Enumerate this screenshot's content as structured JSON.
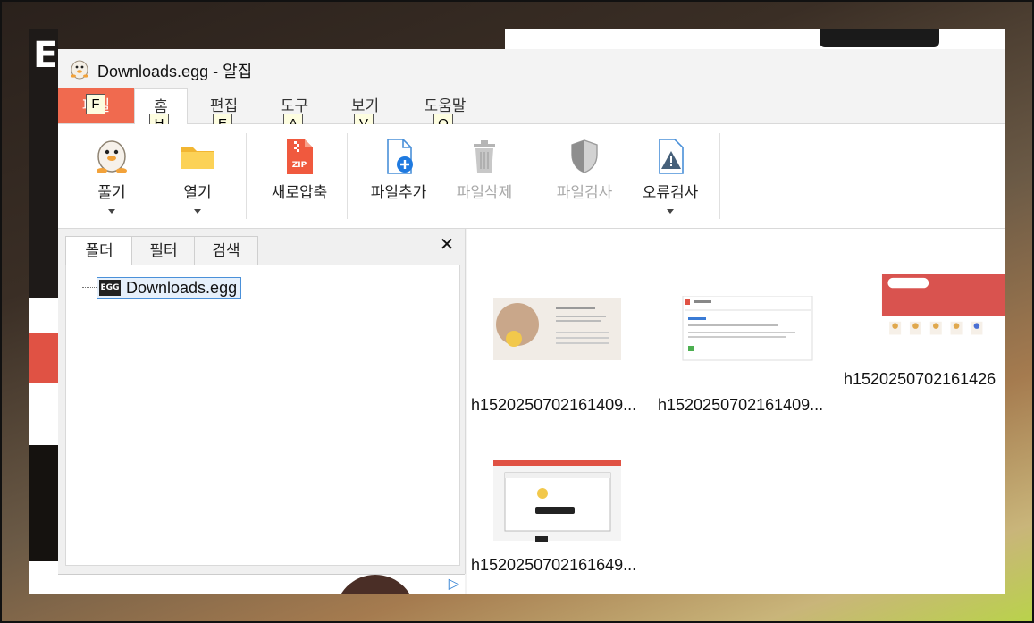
{
  "window": {
    "title": "Downloads.egg - 알집"
  },
  "menu_tabs": [
    {
      "label": "파일",
      "keytip": "F"
    },
    {
      "label": "홈",
      "keytip": "H"
    },
    {
      "label": "편집",
      "keytip": "E"
    },
    {
      "label": "도구",
      "keytip": "A"
    },
    {
      "label": "보기",
      "keytip": "V"
    },
    {
      "label": "도움말",
      "keytip": "O"
    }
  ],
  "ribbon": {
    "extract": {
      "label": "풀기",
      "icon": "egg-mascot-icon"
    },
    "open": {
      "label": "열기",
      "icon": "folder-icon"
    },
    "new_archive": {
      "label": "새로압축",
      "icon": "zip-file-icon",
      "icon_text": "ZIP"
    },
    "add_files": {
      "label": "파일추가",
      "icon": "file-add-icon"
    },
    "delete_files": {
      "label": "파일삭제",
      "icon": "trash-icon"
    },
    "scan_files": {
      "label": "파일검사",
      "icon": "shield-icon"
    },
    "error_check": {
      "label": "오류검사",
      "icon": "warning-file-icon"
    }
  },
  "left_panel": {
    "tabs": [
      "폴더",
      "필터",
      "검색"
    ],
    "close_glyph": "✕",
    "tree_root": {
      "label": "Downloads.egg",
      "badge": "EGG"
    }
  },
  "files": [
    {
      "name": "h1520250702161409..."
    },
    {
      "name": "h1520250702161409..."
    },
    {
      "name": "h1520250702161426"
    },
    {
      "name": "h1520250702161649..."
    }
  ],
  "colors": {
    "file_tab": "#f06a4f",
    "selection": "#e6f0fb",
    "accent_blue": "#2f7fd3"
  }
}
